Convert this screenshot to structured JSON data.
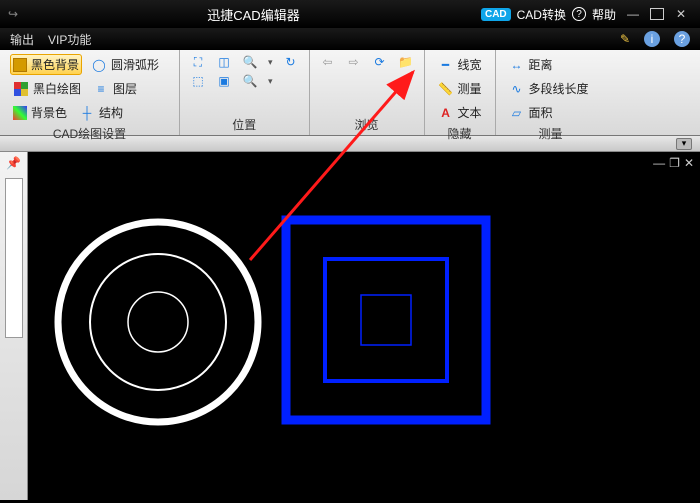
{
  "titlebar": {
    "app_title": "迅捷CAD编辑器",
    "cad_badge": "CAD",
    "convert_label": "CAD转换",
    "help_label": "帮助"
  },
  "menubar": {
    "items": [
      "输出",
      "VIP功能"
    ]
  },
  "ribbon": {
    "group1": {
      "btn_bg": "黑色背景",
      "btn_bw": "黑白绘图",
      "btn_bgcolor": "背景色",
      "btn_arc": "圆滑弧形",
      "btn_layer": "图层",
      "btn_struct": "结构",
      "label": "CAD绘图设置"
    },
    "group2": {
      "label": "位置"
    },
    "group3": {
      "label": "浏览"
    },
    "group4": {
      "btn_lw": "线宽",
      "btn_measure": "测量",
      "btn_text": "文本",
      "label": "隐藏"
    },
    "group5": {
      "btn_dist": "距离",
      "btn_poly": "多段线长度",
      "btn_area": "面积",
      "label": "测量"
    }
  },
  "colors": {
    "accent_blue": "#0020ff",
    "arrow_red": "#ff1a1a"
  }
}
